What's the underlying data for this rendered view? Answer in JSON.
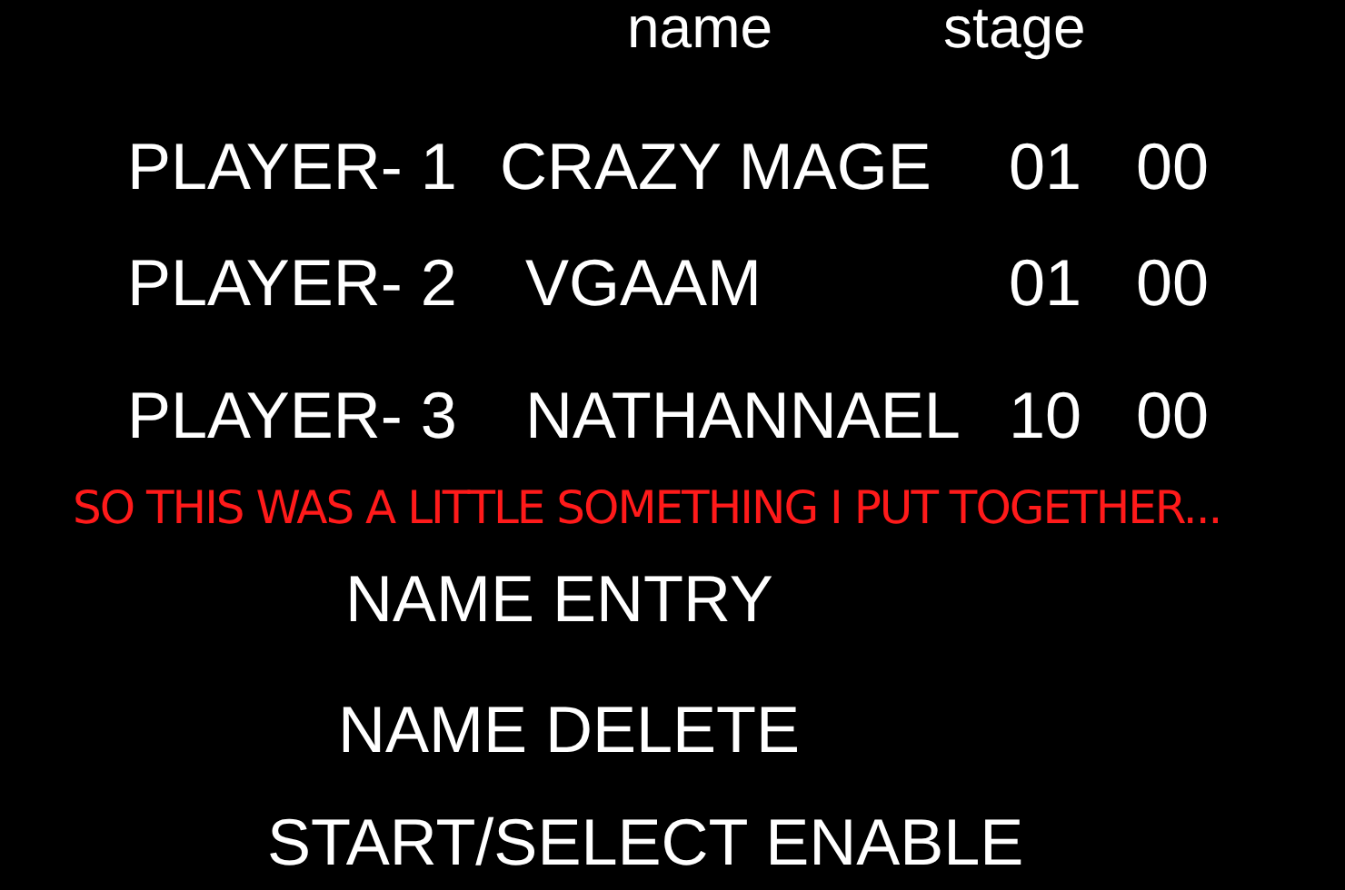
{
  "header": {
    "columns": [
      "name",
      "stage"
    ]
  },
  "players": [
    {
      "label": "PLAYER- 1",
      "name": "CRAZY MAGE",
      "stage": "01",
      "column_4": "00"
    },
    {
      "label": "PLAYER- 2",
      "name": "VGAAM",
      "stage": "01",
      "column_4": "00"
    },
    {
      "label": "PLAYER- 3",
      "name": "NATHANNAEL",
      "stage": "10",
      "column_4": "00"
    }
  ],
  "caption": "SO THIS WAS A LITTLE SOMETHING I PUT TOGETHER...",
  "menu": [
    "NAME ENTRY",
    "NAME DELETE",
    "START/SELECT ENABLE"
  ]
}
